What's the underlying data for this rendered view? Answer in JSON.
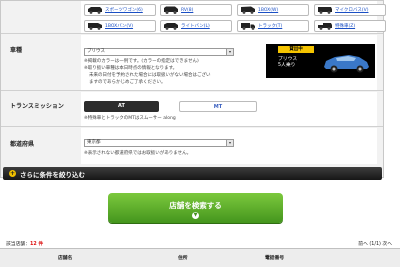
{
  "vehicle_types": [
    {
      "label": "スポーツワゴン(6)",
      "icon": "wagon-icon"
    },
    {
      "label": "RV(8)",
      "icon": "suv-icon"
    },
    {
      "label": "1BOX(W)",
      "icon": "van-icon"
    },
    {
      "label": "マイクロバス(V)",
      "icon": "microbus-icon"
    },
    {
      "label": "1BOXバン(V)",
      "icon": "cargo-van-icon"
    },
    {
      "label": "ライトバン(L)",
      "icon": "light-van-icon"
    },
    {
      "label": "トラック(T)",
      "icon": "truck-icon"
    },
    {
      "label": "特殊車(Z)",
      "icon": "special-vehicle-icon"
    }
  ],
  "model_section": {
    "label": "車種",
    "select_value": "プリウス",
    "notes": [
      "※掲載のカラーは一例です。(カラーの指定はできません)",
      "※取り扱い車種は本日時点の情報となります。",
      "未来の日付を予約された場合には取扱いがない場合はござい",
      "ますのであらかじめご了承ください。"
    ],
    "card_badge": "貸出中",
    "card_name": "プリウス",
    "card_capacity": "5人乗り"
  },
  "transmission_section": {
    "label": "トランスミッション",
    "at_label": "AT",
    "mt_label": "MT",
    "note": "※特殊車とトラックのMTはスムーサー along"
  },
  "prefecture_section": {
    "label": "都道府県",
    "select_value": "東京都",
    "note": "※表示されない都道府県ではお取扱いがありません。"
  },
  "more_filters": {
    "label": "さらに条件を絞り込む",
    "icon_glyph": "+"
  },
  "search_button": {
    "label": "店舗を検索する",
    "arrow_glyph": "▼"
  },
  "results": {
    "count_prefix": "該当店舗：",
    "count_value": "12 件",
    "pager": "前へ (1/1) 次へ",
    "columns": [
      "店舗名",
      "住所",
      "電話番号"
    ]
  },
  "colors": {
    "accent_green": "#5cb22a",
    "badge_yellow": "#f5c400",
    "link_blue": "#1a4fc4"
  }
}
